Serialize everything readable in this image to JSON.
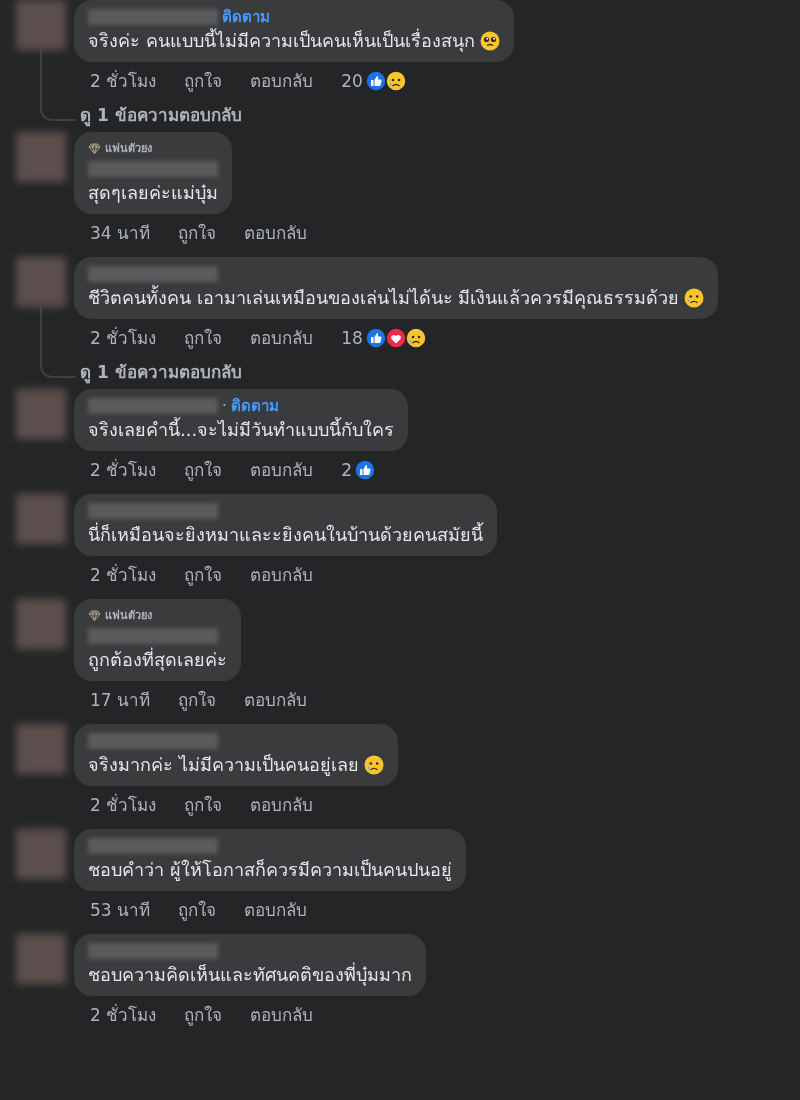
{
  "comments": [
    {
      "follow": {
        "label": "ติดตาม"
      },
      "text": "จริงค่ะ คนแบบนี้ไม่มีความเป็นคนเห็นเป็นเรื่องสนุก",
      "end_icon": {
        "kind": "pleading"
      },
      "time": "2 ชั่วโมง",
      "like": "ถูกใจ",
      "reply": "ตอบกลับ",
      "reactions": {
        "count": "20",
        "icons": [
          {
            "kind": "like"
          },
          {
            "kind": "sad"
          }
        ]
      },
      "replies_link": "ดู 1 ข้อความตอบกลับ"
    },
    {
      "badge": "แฟนตัวยง",
      "text": "สุดๆเลยค่ะแม่บุ๋ม",
      "time": "34 นาที",
      "like": "ถูกใจ",
      "reply": "ตอบกลับ"
    },
    {
      "text": "ชีวิตคนทั้งคน เอามาเล่นเหมือนของเล่นไม่ได้นะ มีเงินแล้วควรมีคุณธรรมด้วย",
      "end_icon": {
        "kind": "sad"
      },
      "time": "2 ชั่วโมง",
      "like": "ถูกใจ",
      "reply": "ตอบกลับ",
      "reactions": {
        "count": "18",
        "icons": [
          {
            "kind": "like"
          },
          {
            "kind": "love"
          },
          {
            "kind": "sad"
          }
        ]
      },
      "replies_link": "ดู 1 ข้อความตอบกลับ"
    },
    {
      "follow": {
        "separator": "·",
        "label": "ติดตาม"
      },
      "text": "จริงเลยคำนี้...จะไม่มีวันทำแบบนี้กับใคร",
      "time": "2 ชั่วโมง",
      "like": "ถูกใจ",
      "reply": "ตอบกลับ",
      "reactions": {
        "count": "2",
        "icons": [
          {
            "kind": "like"
          }
        ]
      }
    },
    {
      "text": "นี่ก็เหมือนจะยิงหมาและะยิงคนในบ้านด้วยคนสมัยนี้",
      "time": "2 ชั่วโมง",
      "like": "ถูกใจ",
      "reply": "ตอบกลับ"
    },
    {
      "badge": "แฟนตัวยง",
      "text": "ถูกต้องที่สุดเลยค่ะ",
      "time": "17 นาที",
      "like": "ถูกใจ",
      "reply": "ตอบกลับ"
    },
    {
      "text": "จริงมากค่ะ ไม่มีความเป็นคนอยู่เลย",
      "end_icon": {
        "kind": "sad"
      },
      "time": "2 ชั่วโมง",
      "like": "ถูกใจ",
      "reply": "ตอบกลับ"
    },
    {
      "text": "ชอบคำว่า ผู้ให้โอกาสก็ควรมีความเป็นคนปนอยู่",
      "time": "53 นาที",
      "like": "ถูกใจ",
      "reply": "ตอบกลับ"
    },
    {
      "text": "ชอบความคิดเห็นและทัศนคติของพี่บุ๋มมาก",
      "time": "2 ชั่วโมง",
      "like": "ถูกใจ",
      "reply": "ตอบกลับ"
    }
  ]
}
